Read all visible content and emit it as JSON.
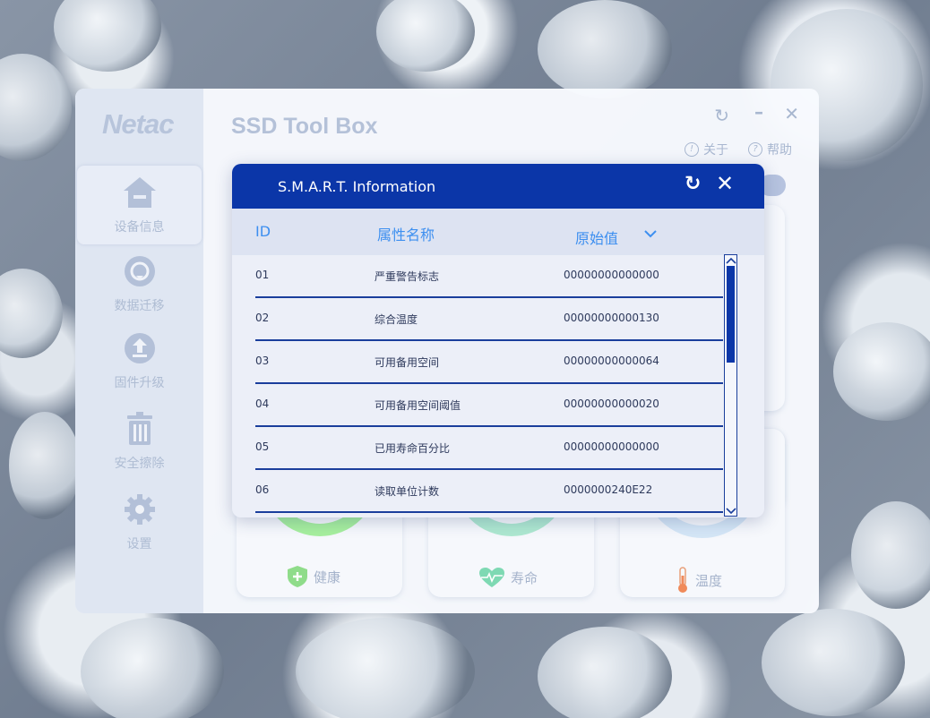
{
  "app": {
    "logo": "Netac",
    "title": "SSD Tool Box",
    "about": "关于",
    "help": "帮助"
  },
  "sidebar": {
    "items": [
      {
        "label": "设备信息",
        "icon": "home-icon"
      },
      {
        "label": "数据迁移",
        "icon": "migrate-icon"
      },
      {
        "label": "固件升级",
        "icon": "upgrade-icon"
      },
      {
        "label": "安全擦除",
        "icon": "trash-icon"
      },
      {
        "label": "设置",
        "icon": "gear-icon"
      }
    ]
  },
  "cards": {
    "health_label": "健康",
    "life_label": "寿命",
    "temp_label": "温度"
  },
  "modal": {
    "title": "S.M.A.R.T. Information",
    "columns": [
      "ID",
      "属性名称",
      "原始值"
    ],
    "rows": [
      {
        "id": "01",
        "name": "严重警告标志",
        "raw": "00000000000000"
      },
      {
        "id": "02",
        "name": "综合温度",
        "raw": "00000000000130"
      },
      {
        "id": "03",
        "name": "可用备用空间",
        "raw": "00000000000064"
      },
      {
        "id": "04",
        "name": "可用备用空间阈值",
        "raw": "00000000000020"
      },
      {
        "id": "05",
        "name": "已用寿命百分比",
        "raw": "00000000000000"
      },
      {
        "id": "06",
        "name": "读取单位计数",
        "raw": "0000000240E22"
      }
    ]
  },
  "colors": {
    "accent": "#0b36a8",
    "header_text": "#3d8ff0"
  }
}
